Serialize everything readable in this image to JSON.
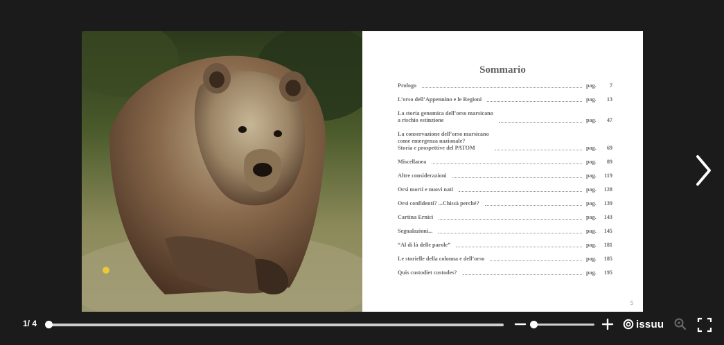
{
  "toc": {
    "title": "Sommario",
    "items": [
      {
        "title": "Prologo",
        "pag": "pag.",
        "page": "7"
      },
      {
        "title": "L’orso dell’Appennino e le Regioni",
        "pag": "pag.",
        "page": "13"
      },
      {
        "title": "La storia genomica dell’orso marsicano\na rischio estinzione",
        "pag": "pag.",
        "page": "47"
      },
      {
        "title": "La conservazione dell’orso marsicano\ncome emergenza nazionale?\nStoria e prospettive del PATOM",
        "pag": "pag.",
        "page": "69"
      },
      {
        "title": "Miscellanea",
        "pag": "pag.",
        "page": "89"
      },
      {
        "title": "Altre considerazioni",
        "pag": "pag.",
        "page": "119"
      },
      {
        "title": "Orsi morti e nuovi nati",
        "pag": "pag.",
        "page": "128"
      },
      {
        "title": "Orsi confidenti? ...Chissà perché?",
        "pag": "pag.",
        "page": "139"
      },
      {
        "title": "Cartina Ernici",
        "pag": "pag.",
        "page": "143"
      },
      {
        "title": "Segnalazioni...",
        "pag": "pag.",
        "page": "145"
      },
      {
        "title": "“Al di là delle parole”",
        "pag": "pag.",
        "page": "181"
      },
      {
        "title": "Le storielle della colonna e dell’orso",
        "pag": "pag.",
        "page": "185"
      },
      {
        "title": "Quis custodiet custodes?",
        "pag": "pag.",
        "page": "195"
      }
    ],
    "folio": "5"
  },
  "toolbar": {
    "page_counter": "1/ 4",
    "progress": 0.0,
    "zoom_level": 0.0,
    "brand": "issuu"
  },
  "icons": {
    "next": "chevron-right-icon",
    "zoom_out": "minus-icon",
    "zoom_in": "plus-icon",
    "brand_logo": "issuu-logo-icon",
    "magnifier": "magnifier-icon",
    "fullscreen": "fullscreen-icon"
  },
  "colors": {
    "background": "#1b1b1b",
    "page": "#ffffff",
    "text": "#6a6a6a",
    "track": "#cfcfcf"
  }
}
